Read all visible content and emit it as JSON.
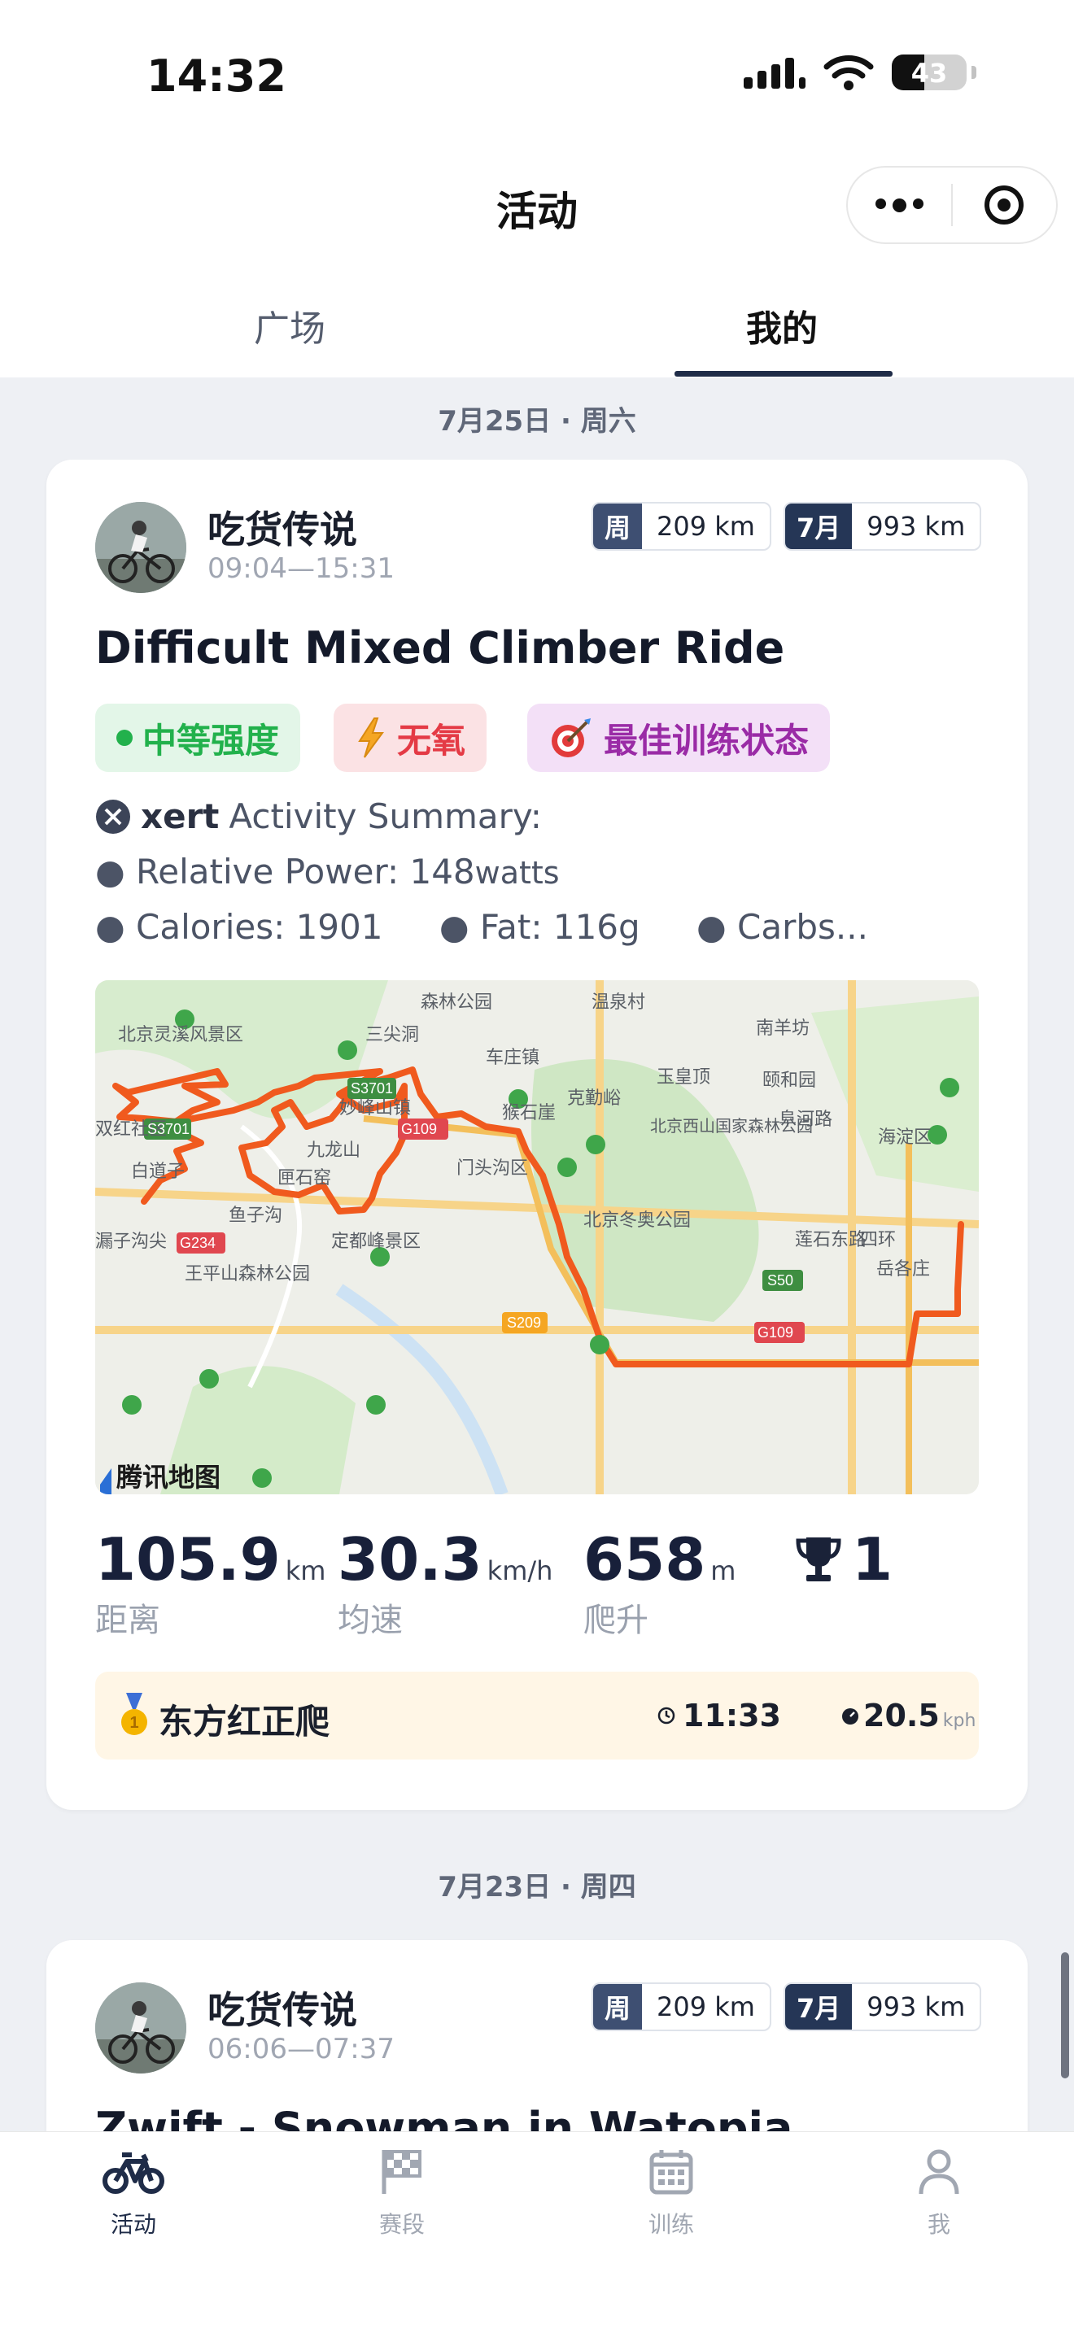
{
  "status_bar": {
    "time": "14:32",
    "battery": "43",
    "battery_level": 0.43
  },
  "header": {
    "title": "活动"
  },
  "tabs": [
    {
      "label": "广场",
      "active": false
    },
    {
      "label": "我的",
      "active": true
    }
  ],
  "activities": [
    {
      "date": "7月25日 · 周六",
      "user": "吃货传说",
      "time_range": "09:04—15:31",
      "week_label": "周",
      "week_value": "209 km",
      "month_label": "7月",
      "month_value": "993 km",
      "title": "Difficult Mixed Climber Ride",
      "tags": [
        {
          "label": "中等强度",
          "icon": "green-dot-icon"
        },
        {
          "label": "无氧",
          "icon": "lightning-icon"
        },
        {
          "label": "最佳训练状态",
          "icon": "target-dart-icon"
        }
      ],
      "summary": {
        "brand": "xert",
        "heading": "Activity Summary:",
        "relative_power_label": "Relative Power: 148",
        "relative_power_unit": "watts",
        "calories": "Calories: 1901",
        "fat": "Fat: 116g",
        "carbs": "Carbs..."
      },
      "map": {
        "attribution": "腾讯地图",
        "places": [
          "森林公园",
          "温泉村",
          "北京灵溪风景区",
          "三尖洞",
          "南羊坊",
          "车庄镇",
          "玉皇顶",
          "颐和园",
          "克勤峪",
          "猴石崖",
          "北京西山国家森林公园",
          "海淀区",
          "妙峰山镇",
          "双红社区",
          "九龙山",
          "门头沟区",
          "白道子",
          "匣石窑",
          "鱼子沟",
          "北京冬奥公园",
          "莲石东路",
          "四环",
          "漏子沟尖",
          "定都峰景区",
          "王平山森林公园",
          "岳各庄",
          "阜河路"
        ],
        "road_labels": [
          "S3701",
          "G109",
          "G234",
          "S50",
          "S209"
        ]
      },
      "stats": [
        {
          "value": "105.9",
          "unit": "km",
          "label": "距离"
        },
        {
          "value": "30.3",
          "unit": "km/h",
          "label": "均速"
        },
        {
          "value": "658",
          "unit": "m",
          "label": "爬升"
        },
        {
          "value": "1",
          "icon": "trophy-icon"
        }
      ],
      "segment": {
        "name": "东方红正爬",
        "time": "11:33",
        "speed": "20.5",
        "speed_unit": "kph"
      }
    },
    {
      "date": "7月23日 · 周四",
      "user": "吃货传说",
      "time_range": "06:06—07:37",
      "week_label": "周",
      "week_value": "209 km",
      "month_label": "7月",
      "month_value": "993 km",
      "title": "Zwift - Snowman in Watopia"
    }
  ],
  "bottom_nav": [
    {
      "label": "活动",
      "icon": "bicycle-icon",
      "active": true
    },
    {
      "label": "赛段",
      "icon": "checkered-flag-icon",
      "active": false
    },
    {
      "label": "训练",
      "icon": "calendar-icon",
      "active": false
    },
    {
      "label": "我",
      "icon": "person-icon",
      "active": false
    }
  ],
  "colors": {
    "accent": "#1f2c48",
    "route": "#f05a1e",
    "green": "#22b14c",
    "red": "#e43a45",
    "purple": "#9a2ba6"
  }
}
